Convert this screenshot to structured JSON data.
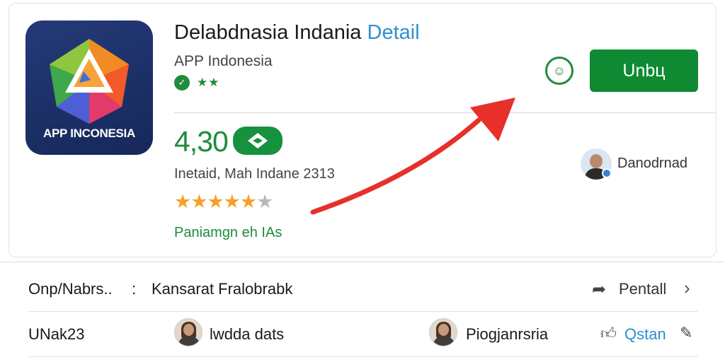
{
  "app": {
    "title_main": "Delabdnasia Indania",
    "title_accent": "Detail",
    "publisher": "APP Indonesia",
    "icon_label": "APP INCONESIA",
    "badge_stars": "★★"
  },
  "actions": {
    "install_label": "Unbц",
    "wishlist_glyph": "☺"
  },
  "rating": {
    "value": "4,30",
    "meta": "Inetaid, Mah Indane 2313",
    "stars_filled": 5,
    "stars_total": 6,
    "reviews_link": "Paniamgn eh IAs"
  },
  "developer": {
    "name": "Danodrnad"
  },
  "rows": [
    {
      "left": "Onp/Nabrs..",
      "separator": ":",
      "middle": "Kansarat Fralobrabk",
      "right": "Pentall"
    },
    {
      "left": "UNak23",
      "person_a": "lwdda dats",
      "person_b": "Piogjanrsria",
      "right": "Qstan"
    }
  ],
  "colors": {
    "accent_green": "#0f8a32",
    "accent_blue": "#2f8fd0",
    "star_orange": "#f3a12a",
    "arrow_red": "#e8302a"
  }
}
